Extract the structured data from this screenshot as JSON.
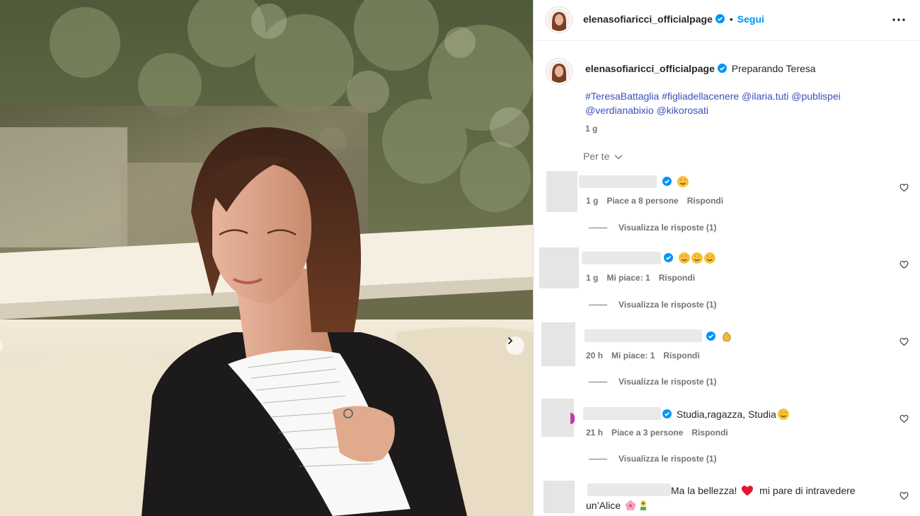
{
  "post": {
    "author": "elenasofiaricci_officialpage",
    "follow_label": "Segui",
    "dot": "•",
    "caption_text": "Preparando Teresa",
    "caption_tags_line1": "#TeresaBattaglia #figliadellacenere @ilaria.tuti @publispei",
    "caption_tags_line2": "@verdianabixio @kikorosati",
    "age": "1 g",
    "sort_label": "Per te"
  },
  "comments": [
    {
      "text": "",
      "emojis": [
        "star-struck"
      ],
      "age": "1 g",
      "likes": "Piace a 8 persone",
      "reply_label": "Rispondi",
      "view_replies": "Visualizza le risposte (1)"
    },
    {
      "text": "",
      "emojis": [
        "star-struck",
        "star-struck",
        "star-struck"
      ],
      "age": "1 g",
      "likes": "Mi piace: 1",
      "reply_label": "Rispondi",
      "view_replies": "Visualizza le risposte (1)"
    },
    {
      "text": "",
      "emojis": [
        "clapping-hands"
      ],
      "age": "20 h",
      "likes": "Mi piace: 1",
      "reply_label": "Rispondi",
      "view_replies": "Visualizza le risposte (1)"
    },
    {
      "text": "Studia,ragazza, Studia",
      "emojis": [
        "star-struck"
      ],
      "age": "21 h",
      "likes": "Piace a 3 persone",
      "reply_label": "Rispondi",
      "view_replies": "Visualizza le risposte (1)"
    },
    {
      "text": "Ma la bellezza!",
      "text_after_heart": "mi pare di intravedere",
      "text_line2": "un’Alice",
      "emojis": [
        "red-heart",
        "cherry-blossom",
        "sunflower-pot"
      ]
    }
  ],
  "icons": {
    "verified": "verified-badge-icon",
    "more": "more-options-icon",
    "chevron": "chevron-down-icon",
    "heart": "heart-outline-icon",
    "next": "chevron-right-icon"
  },
  "colors": {
    "link": "#0095f6",
    "verified": "#0095f6",
    "tag": "#3a4fbf",
    "muted": "#737373"
  }
}
